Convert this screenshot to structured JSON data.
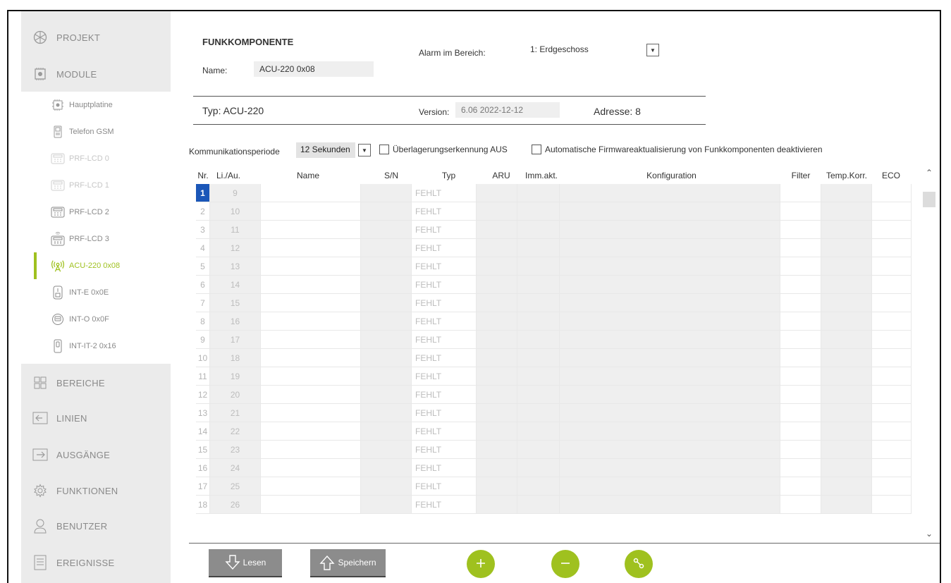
{
  "sidebar": {
    "main_items": [
      {
        "label": "PROJEKT",
        "icon": "cube-icon"
      },
      {
        "label": "MODULE",
        "icon": "module-icon"
      },
      {
        "label": "BEREICHE",
        "icon": "partitions-icon"
      },
      {
        "label": "LINIEN",
        "icon": "zones-icon"
      },
      {
        "label": "AUSGÄNGE",
        "icon": "outputs-icon"
      },
      {
        "label": "FUNKTIONEN",
        "icon": "gear-icon"
      },
      {
        "label": "BENUTZER",
        "icon": "user-icon"
      },
      {
        "label": "EREIGNISSE",
        "icon": "events-icon"
      }
    ],
    "sub_items": [
      {
        "label": "Hauptplatine",
        "icon": "mainboard-icon"
      },
      {
        "label": "Telefon GSM",
        "icon": "phone-icon"
      },
      {
        "label": "PRF-LCD 0",
        "icon": "keypad-icon"
      },
      {
        "label": "PRF-LCD 1",
        "icon": "keypad-icon"
      },
      {
        "label": "PRF-LCD 2",
        "icon": "keypad-icon"
      },
      {
        "label": "PRF-LCD 3",
        "icon": "wireless-keypad-icon"
      },
      {
        "label": "ACU-220 0x08",
        "icon": "antenna-icon"
      },
      {
        "label": "INT-E 0x0E",
        "icon": "expander-icon"
      },
      {
        "label": "INT-O 0x0F",
        "icon": "output-expander-icon"
      },
      {
        "label": "INT-IT-2 0x16",
        "icon": "proximity-icon"
      }
    ]
  },
  "header": {
    "section_title": "FUNKKOMPONENTE",
    "name_label": "Name:",
    "name_value": "ACU-220 0x08",
    "alarm_label": "Alarm im Bereich:",
    "alarm_value": "1: Erdgeschoss",
    "typ_label": "Typ:",
    "typ_value": "ACU-220",
    "version_label": "Version:",
    "version_value": "6.06 2022-12-12",
    "address_label": "Adresse:",
    "address_value": "8"
  },
  "options": {
    "period_label": "Kommunikationsperiode",
    "period_value": "12 Sekunden",
    "jam_label": "Überlagerungserkennung AUS",
    "firmware_label": "Automatische Firmwareaktualisierung von Funkkomponenten deaktivieren"
  },
  "table": {
    "columns": [
      "Nr.",
      "Li./Au.",
      "Name",
      "S/N",
      "Typ",
      "ARU",
      "Imm.akt.",
      "Konfiguration",
      "Filter",
      "Temp.Korr.",
      "ECO"
    ],
    "rows": [
      {
        "nr": "1",
        "line": "9",
        "typ": "FEHLT"
      },
      {
        "nr": "2",
        "line": "10",
        "typ": "FEHLT"
      },
      {
        "nr": "3",
        "line": "11",
        "typ": "FEHLT"
      },
      {
        "nr": "4",
        "line": "12",
        "typ": "FEHLT"
      },
      {
        "nr": "5",
        "line": "13",
        "typ": "FEHLT"
      },
      {
        "nr": "6",
        "line": "14",
        "typ": "FEHLT"
      },
      {
        "nr": "7",
        "line": "15",
        "typ": "FEHLT"
      },
      {
        "nr": "8",
        "line": "16",
        "typ": "FEHLT"
      },
      {
        "nr": "9",
        "line": "17",
        "typ": "FEHLT"
      },
      {
        "nr": "10",
        "line": "18",
        "typ": "FEHLT"
      },
      {
        "nr": "11",
        "line": "19",
        "typ": "FEHLT"
      },
      {
        "nr": "12",
        "line": "20",
        "typ": "FEHLT"
      },
      {
        "nr": "13",
        "line": "21",
        "typ": "FEHLT"
      },
      {
        "nr": "14",
        "line": "22",
        "typ": "FEHLT"
      },
      {
        "nr": "15",
        "line": "23",
        "typ": "FEHLT"
      },
      {
        "nr": "16",
        "line": "24",
        "typ": "FEHLT"
      },
      {
        "nr": "17",
        "line": "25",
        "typ": "FEHLT"
      },
      {
        "nr": "18",
        "line": "26",
        "typ": "FEHLT"
      }
    ]
  },
  "buttons": {
    "read_label": "Lesen",
    "save_label": "Speichern"
  },
  "colors": {
    "accent": "#9fc11f",
    "selection": "#1b57b8",
    "sidebar_bg": "#ebebeb"
  }
}
